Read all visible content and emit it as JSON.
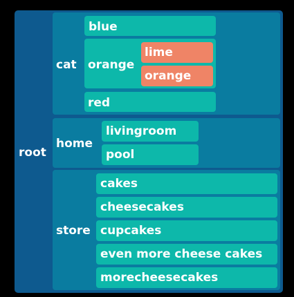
{
  "tree": {
    "root": "root",
    "cat": {
      "label": "cat",
      "blue": "blue",
      "orange": {
        "label": "orange",
        "lime": "lime",
        "orange": "orange"
      },
      "red": "red"
    },
    "home": {
      "label": "home",
      "livingroom": "livingroom",
      "pool": "pool"
    },
    "store": {
      "label": "store",
      "cakes": "cakes",
      "cheesecakes": "cheesecakes",
      "cupcakes": "cupcakes",
      "even_more": "even more cheese cakes",
      "morecheesecakes": "morecheesecakes"
    }
  },
  "colors": {
    "background": "#000000",
    "level0": "#0e5a8f",
    "level1": "#0a7ca0",
    "level2": "#0db8aa",
    "leaf_accent": "#ef8466",
    "text": "#ffffff"
  }
}
